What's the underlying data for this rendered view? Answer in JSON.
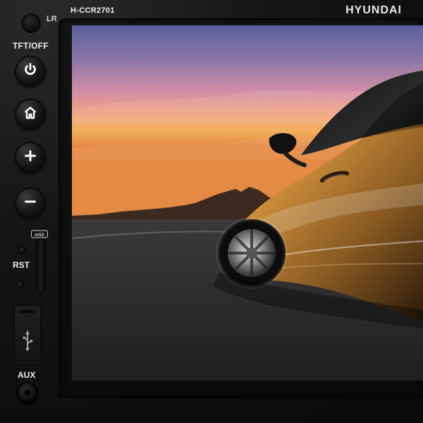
{
  "device": {
    "model": "H-CCR2701",
    "brand": "HYUNDAI"
  },
  "left_panel": {
    "ir_mark": "LR",
    "tft_off_label": "TFT/OFF",
    "microsd_label": "micro SD",
    "rst_label": "RST",
    "aux_label": "AUX",
    "buttons": [
      {
        "name": "power",
        "icon": "power-icon"
      },
      {
        "name": "home",
        "icon": "home-icon"
      },
      {
        "name": "volume_up",
        "icon": "plus-icon"
      },
      {
        "name": "volume_down",
        "icon": "minus-icon"
      }
    ],
    "usb_icon": "usb-icon"
  },
  "screen": {
    "scene": "car-at-sunset",
    "colors": {
      "sky_top": "#6a6aa8",
      "sky_mid": "#d98fa6",
      "sky_horizon": "#f3a85a",
      "asphalt": "#2a2a2a",
      "car_gold": "#c88b3a"
    }
  }
}
